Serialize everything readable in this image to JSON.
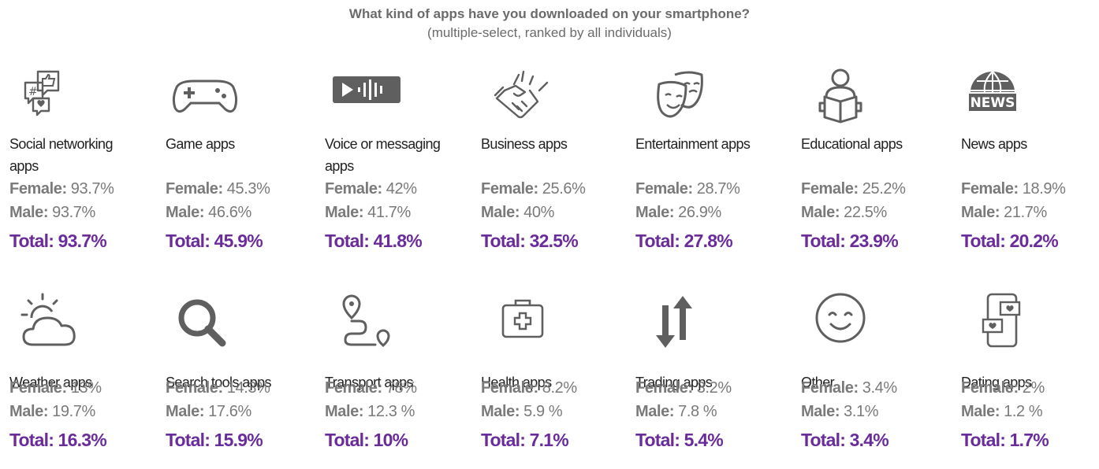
{
  "title": "What kind of apps have you downloaded on your smartphone?",
  "subtitle": "(multiple-select, ranked by all individuals)",
  "colors": {
    "accent": "#6b2c9b",
    "stat": "#7a7a7a",
    "icon": "#5f5f5f"
  },
  "cards": [
    {
      "icon": "social-networking-icon",
      "label": "Social networking apps",
      "female_label": "Female:",
      "female": "93.7%",
      "male_label": "Male:",
      "male": "93.7%",
      "total": "Total: 93.7%"
    },
    {
      "icon": "gamepad-icon",
      "label": "Game apps",
      "female_label": "Female:",
      "female": "45.3%",
      "male_label": "Male:",
      "male": "46.6%",
      "total": "Total: 45.9%"
    },
    {
      "icon": "voice-message-icon",
      "label": "Voice or messaging apps",
      "female_label": "Female:",
      "female": "42%",
      "male_label": "Male:",
      "male": "41.7%",
      "total": "Total: 41.8%"
    },
    {
      "icon": "handshake-icon",
      "label": "Business apps",
      "female_label": "Female:",
      "female": "25.6%",
      "male_label": "Male:",
      "male": "40%",
      "total": "Total: 32.5%"
    },
    {
      "icon": "theater-masks-icon",
      "label": "Entertainment apps",
      "female_label": "Female:",
      "female": "28.7%",
      "male_label": "Male:",
      "male": "26.9%",
      "total": "Total: 27.8%"
    },
    {
      "icon": "reader-icon",
      "label": "Educational apps",
      "female_label": "Female:",
      "female": "25.2%",
      "male_label": "Male:",
      "male": "22.5%",
      "total": "Total: 23.9%"
    },
    {
      "icon": "news-globe-icon",
      "label": "News apps",
      "female_label": "Female:",
      "female": "18.9%",
      "male_label": "Male:",
      "male": "21.7%",
      "total": "Total: 20.2%",
      "icon_text": "NEWS"
    },
    {
      "icon": "weather-icon",
      "label": "Weather apps",
      "female_label": "Female:",
      "female": "13%",
      "male_label": "Male:",
      "male": "19.7%",
      "total": "Total: 16.3%"
    },
    {
      "icon": "search-icon",
      "label": "Search tools apps",
      "female_label": "Female:",
      "female": "14.3%",
      "male_label": "Male:",
      "male": "17.6%",
      "total": "Total: 15.9%"
    },
    {
      "icon": "route-pin-icon",
      "label": "Transport apps",
      "female_label": "Female:",
      "female": "78%",
      "male_label": "Male:",
      "male": "12.3 %",
      "total": "Total: 10%"
    },
    {
      "icon": "first-aid-kit-icon",
      "label": "Health apps",
      "female_label": "Female:",
      "female": "8.2%",
      "male_label": "Male:",
      "male": "5.9 %",
      "total": "Total: 7.1%"
    },
    {
      "icon": "up-down-arrows-icon",
      "label": "Trading apps",
      "female_label": "Female:",
      "female": "3.2%",
      "male_label": "Male:",
      "male": "7.8 %",
      "total": "Total: 5.4%"
    },
    {
      "icon": "smiley-icon",
      "label": "Other",
      "female_label": "Female:",
      "female": "3.4%",
      "male_label": "Male:",
      "male": "3.1%",
      "total": "Total: 3.4%"
    },
    {
      "icon": "dating-phone-icon",
      "label": "Dating apps",
      "female_label": "Female:",
      "female": "2%",
      "male_label": "Male:",
      "male": "1.2 %",
      "total": "Total: 1.7%"
    }
  ],
  "chart_data": {
    "type": "table",
    "title": "What kind of apps have you downloaded on your smartphone?",
    "subtitle": "(multiple-select, ranked by all individuals)",
    "columns": [
      "Female",
      "Male",
      "Total"
    ],
    "categories": [
      "Social networking apps",
      "Game apps",
      "Voice or messaging apps",
      "Business apps",
      "Entertainment apps",
      "Educational apps",
      "News apps",
      "Weather apps",
      "Search tools apps",
      "Transport apps",
      "Health apps",
      "Trading apps",
      "Other",
      "Dating apps"
    ],
    "series": [
      {
        "name": "Female",
        "values": [
          93.7,
          45.3,
          42,
          25.6,
          28.7,
          25.2,
          18.9,
          13,
          14.3,
          78,
          8.2,
          3.2,
          3.4,
          2
        ]
      },
      {
        "name": "Male",
        "values": [
          93.7,
          46.6,
          41.7,
          40,
          26.9,
          22.5,
          21.7,
          19.7,
          17.6,
          12.3,
          5.9,
          7.8,
          3.1,
          1.2
        ]
      },
      {
        "name": "Total",
        "values": [
          93.7,
          45.9,
          41.8,
          32.5,
          27.8,
          23.9,
          20.2,
          16.3,
          15.9,
          10,
          7.1,
          5.4,
          3.4,
          1.7
        ]
      }
    ],
    "unit": "%"
  }
}
